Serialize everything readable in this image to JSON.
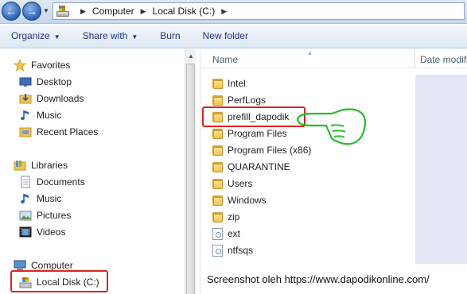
{
  "address_bar": {
    "crumbs": [
      "Computer",
      "Local Disk (C:)"
    ]
  },
  "toolbar": {
    "organize": "Organize",
    "share_with": "Share with",
    "burn": "Burn",
    "new_folder": "New folder"
  },
  "nav": {
    "favorites": "Favorites",
    "desktop": "Desktop",
    "downloads": "Downloads",
    "music": "Music",
    "recent_places": "Recent Places",
    "libraries": "Libraries",
    "documents": "Documents",
    "lib_music": "Music",
    "pictures": "Pictures",
    "videos": "Videos",
    "computer": "Computer",
    "local_disk": "Local Disk (C:)"
  },
  "columns": {
    "name": "Name",
    "date_modified": "Date modifi"
  },
  "files": [
    {
      "name": "Intel",
      "type": "folder"
    },
    {
      "name": "PerfLogs",
      "type": "folder"
    },
    {
      "name": "prefill_dapodik",
      "type": "folder"
    },
    {
      "name": "Program Files",
      "type": "folder"
    },
    {
      "name": "Program Files (x86)",
      "type": "folder"
    },
    {
      "name": "QUARANTINE",
      "type": "folder"
    },
    {
      "name": "Users",
      "type": "folder"
    },
    {
      "name": "Windows",
      "type": "folder"
    },
    {
      "name": "zip",
      "type": "folder"
    },
    {
      "name": "ext",
      "type": "file"
    },
    {
      "name": "ntfsqs",
      "type": "file"
    }
  ],
  "caption": "Screenshot oleh https://www.dapodikonline.com/",
  "colors": {
    "highlight_red": "#e02020",
    "hand_green": "#22c02a",
    "toolbar_text": "#1e3287"
  }
}
